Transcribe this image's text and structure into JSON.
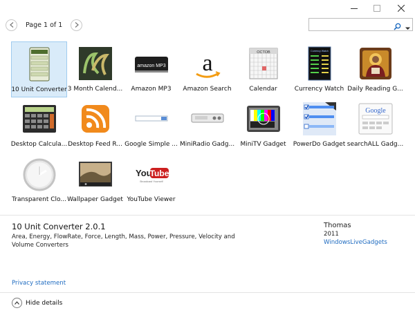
{
  "window": {
    "controls": [
      "minimize-icon",
      "maximize-icon",
      "close-icon"
    ]
  },
  "pager": {
    "label": "Page 1 of 1"
  },
  "search": {
    "placeholder": ""
  },
  "gadgets": [
    {
      "name": "10 Unit Converter",
      "icon": "unit-converter-icon",
      "selected": true
    },
    {
      "name": "3 Month Calend...",
      "icon": "three-month-calendar-icon"
    },
    {
      "name": "Amazon MP3",
      "icon": "amazon-mp3-icon"
    },
    {
      "name": "Amazon Search",
      "icon": "amazon-logo-icon"
    },
    {
      "name": "Calendar",
      "icon": "calendar-icon"
    },
    {
      "name": "Currency Watch",
      "icon": "currency-watch-icon"
    },
    {
      "name": "Daily Reading G...",
      "icon": "daily-reading-icon"
    },
    {
      "name": "Desktop Calcula...",
      "icon": "calculator-icon"
    },
    {
      "name": "Desktop Feed R...",
      "icon": "rss-feed-icon"
    },
    {
      "name": "Google Simple ...",
      "icon": "google-simple-search-icon"
    },
    {
      "name": "MiniRadio Gadg...",
      "icon": "mini-radio-icon"
    },
    {
      "name": "MiniTV Gadget",
      "icon": "mini-tv-icon"
    },
    {
      "name": "PowerDo Gadget",
      "icon": "powerdo-checklist-icon"
    },
    {
      "name": "searchALL Gadg...",
      "icon": "searchall-google-icon"
    },
    {
      "name": "Transparent Clo...",
      "icon": "transparent-clock-icon"
    },
    {
      "name": "Wallpaper Gadget",
      "icon": "wallpaper-icon"
    },
    {
      "name": "YouTube Viewer",
      "icon": "youtube-logo-icon"
    }
  ],
  "art_text": {
    "amazon_mp3": "amazon MP3",
    "youtube_you": "You",
    "youtube_tube": "Tube",
    "youtube_tag": "Broadcast Yourself",
    "google": "Google",
    "currency": "Currency Watch",
    "month": "OCTOB"
  },
  "details": {
    "title": "10 Unit Converter 2.0.1",
    "description": "Area, Energy, FlowRate, Force, Length, Mass, Power, Pressure, Velocity and Volume Converters",
    "author": "Thomas",
    "year": "2011",
    "link": "WindowsLiveGadgets",
    "privacy": "Privacy statement",
    "hide": "Hide details"
  },
  "colors": {
    "selection_bg": "#d9ebf9",
    "selection_border": "#9fcbef",
    "link": "#1e6bc0"
  }
}
